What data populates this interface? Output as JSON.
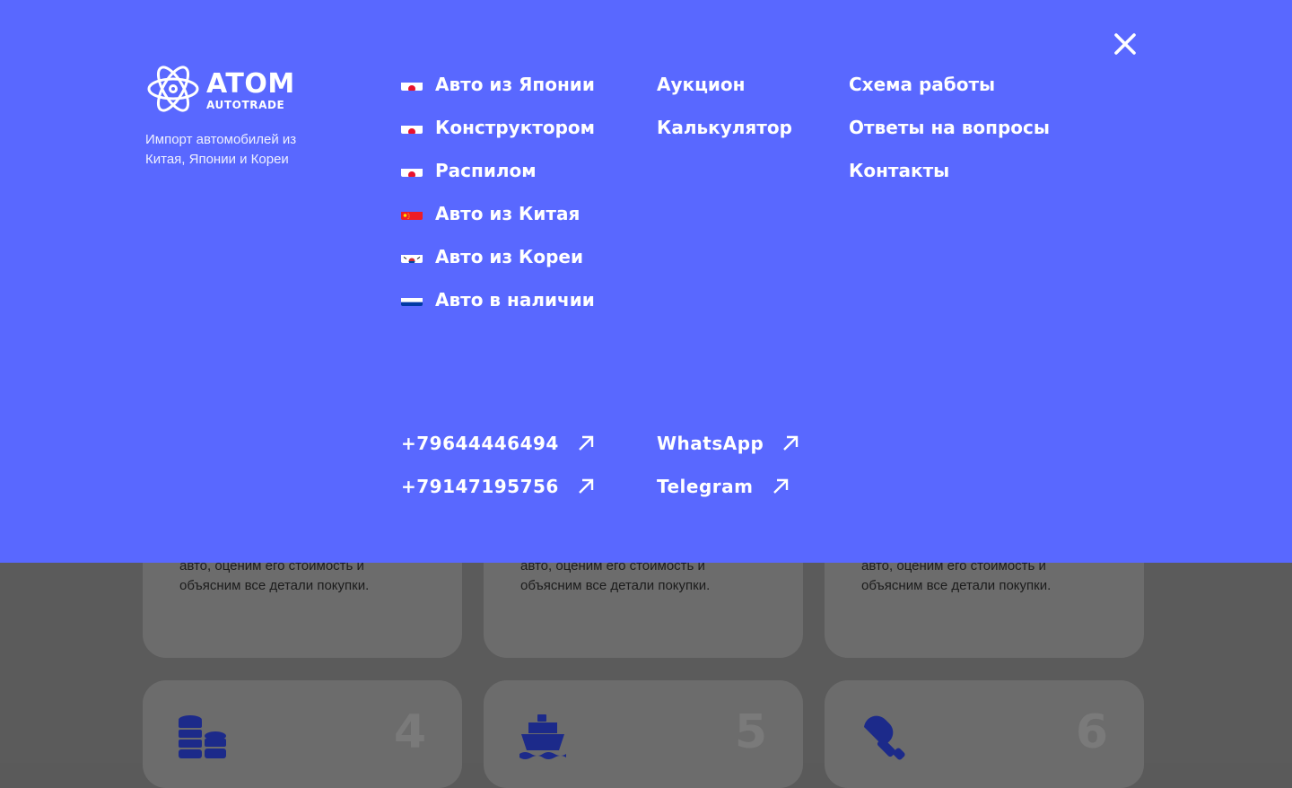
{
  "brand": {
    "name": "ATOM",
    "sub": "AUTOTRADE",
    "tagline": "Импорт автомобилей из Китая, Японии и Кореи"
  },
  "menu": {
    "col1": [
      {
        "label": "Авто из Японии",
        "flag": "japan"
      },
      {
        "label": "Конструктором",
        "flag": "japan"
      },
      {
        "label": "Распилом",
        "flag": "japan"
      },
      {
        "label": "Авто из Китая",
        "flag": "china"
      },
      {
        "label": "Авто из Кореи",
        "flag": "korea"
      },
      {
        "label": "Авто в наличии",
        "flag": "russia"
      }
    ],
    "col2": [
      {
        "label": "Аукцион"
      },
      {
        "label": "Калькулятор"
      }
    ],
    "col3": [
      {
        "label": "Схема работы"
      },
      {
        "label": "Ответы на вопросы"
      },
      {
        "label": "Контакты"
      }
    ]
  },
  "contacts": {
    "phone1": "+79644446494",
    "phone2": "+79147195756",
    "whatsapp": "WhatsApp",
    "telegram": "Telegram",
    "arrow_icon": "arrow-up-right-icon"
  },
  "close_icon": "close-icon",
  "background": {
    "card_text_line1": "авто, оценим его стоимость и",
    "card_text_line2": "объясним все детали покупки.",
    "step_numbers": [
      "4",
      "5",
      "6"
    ],
    "step_icons": [
      "coins-icon",
      "ship-icon",
      "key-icon"
    ]
  },
  "colors": {
    "overlay": "#5968ff",
    "dim": "#5b5b5b",
    "text": "#ffffff"
  }
}
